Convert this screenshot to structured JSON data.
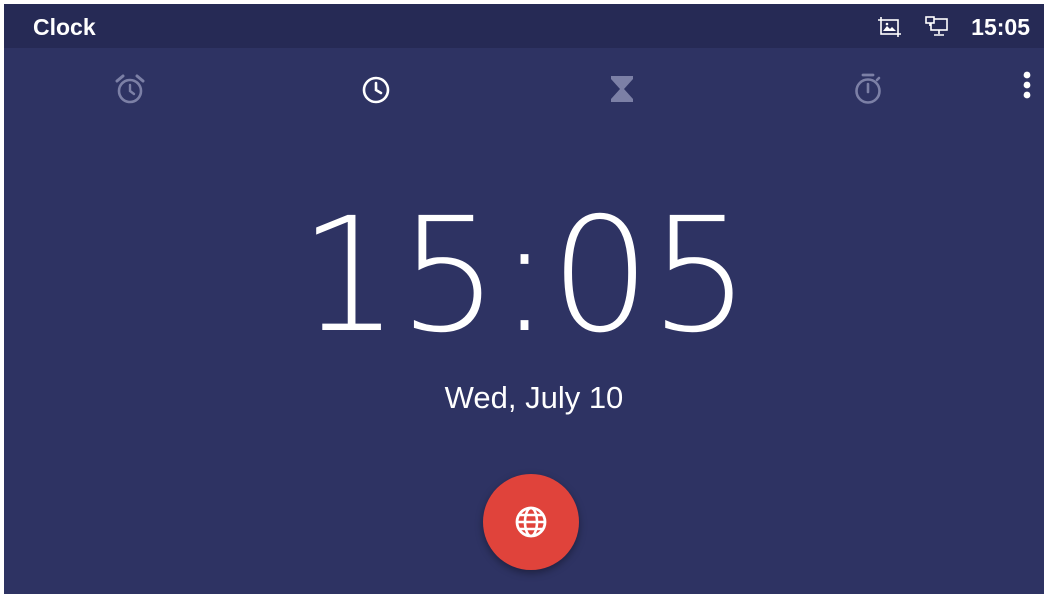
{
  "app": {
    "title": "Clock"
  },
  "status_bar": {
    "time": "15:05",
    "icons": [
      "screenshot-icon",
      "network-icon"
    ]
  },
  "tabs": [
    {
      "name": "alarm",
      "icon": "alarm-clock-icon",
      "active": false
    },
    {
      "name": "clock",
      "icon": "clock-icon",
      "active": true
    },
    {
      "name": "timer",
      "icon": "hourglass-icon",
      "active": false
    },
    {
      "name": "stopwatch",
      "icon": "stopwatch-icon",
      "active": false
    }
  ],
  "menu": {
    "icon": "more-vert-icon"
  },
  "clock": {
    "time": "15:05",
    "date": "Wed, July 10"
  },
  "fab": {
    "icon": "globe-icon"
  },
  "colors": {
    "background": "#2e3363",
    "status_bar": "#262a55",
    "fab": "#e0433b",
    "icon_inactive": "#7c80a6",
    "icon_active": "#ffffff"
  }
}
